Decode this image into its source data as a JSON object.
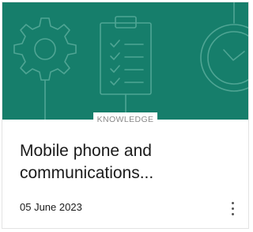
{
  "card": {
    "category": "KNOWLEDGE",
    "title": "Mobile phone and communications...",
    "date": "05 June 2023",
    "menu_icon": "more-vertical-icon",
    "banner_color": "#167e6b",
    "banner_icons": [
      "gear-icon",
      "clipboard-checklist-icon",
      "stopwatch-icon"
    ]
  }
}
